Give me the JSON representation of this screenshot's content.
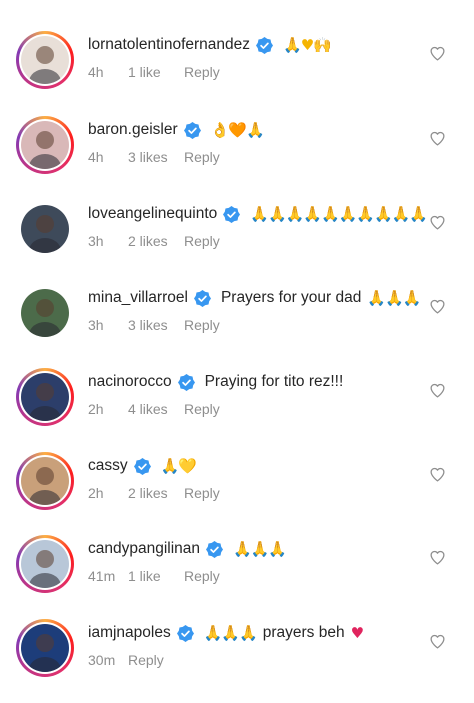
{
  "comments": [
    {
      "username": "lornatolentinofernandez",
      "verified": true,
      "text": "",
      "emoji": "🙏♥🙌",
      "time": "4h",
      "likes": "1 like",
      "reply": "Reply",
      "avatar_bg": "#e8dfd8",
      "ring": true
    },
    {
      "username": "baron.geisler",
      "verified": true,
      "text": "",
      "emoji": "👌🧡🙏",
      "time": "4h",
      "likes": "3 likes",
      "reply": "Reply",
      "avatar_bg": "#d9b8b8",
      "ring": true
    },
    {
      "username": "loveangelinequinto",
      "verified": true,
      "text": "",
      "emoji": "🙏🙏🙏🙏🙏🙏🙏🙏🙏🙏",
      "time": "3h",
      "likes": "2 likes",
      "reply": "Reply",
      "avatar_bg": "#3e4a5a",
      "ring": false
    },
    {
      "username": "mina_villarroel",
      "verified": true,
      "text": "Prayers for your dad",
      "emoji": "🙏🙏🙏",
      "time": "3h",
      "likes": "3 likes",
      "reply": "Reply",
      "avatar_bg": "#4c6b4a",
      "ring": false
    },
    {
      "username": "nacinorocco",
      "verified": true,
      "text": "Praying for tito rez!!!",
      "emoji": "",
      "time": "2h",
      "likes": "4 likes",
      "reply": "Reply",
      "avatar_bg": "#2c3e6a",
      "ring": true
    },
    {
      "username": "cassy",
      "verified": true,
      "text": "",
      "emoji": "🙏💛",
      "time": "2h",
      "likes": "2 likes",
      "reply": "Reply",
      "avatar_bg": "#c9a07a",
      "ring": true
    },
    {
      "username": "candypangilinan",
      "verified": true,
      "text": "",
      "emoji": "🙏🙏🙏",
      "time": "41m",
      "likes": "1 like",
      "reply": "Reply",
      "avatar_bg": "#b8c7d8",
      "ring": true
    },
    {
      "username": "iamjnapoles",
      "verified": true,
      "text": "prayers beh",
      "emoji_before": "🙏🙏🙏",
      "emoji": "♥",
      "time": "30m",
      "likes": "",
      "reply": "Reply",
      "avatar_bg": "#1d3d7a",
      "ring": true
    }
  ],
  "colors": {
    "verified": "#3897f0",
    "meta": "#8e8e8e",
    "heart_outline": "#8e8e8e",
    "emoji_pray": "#f5b400",
    "emoji_heart": "#e0245e"
  }
}
